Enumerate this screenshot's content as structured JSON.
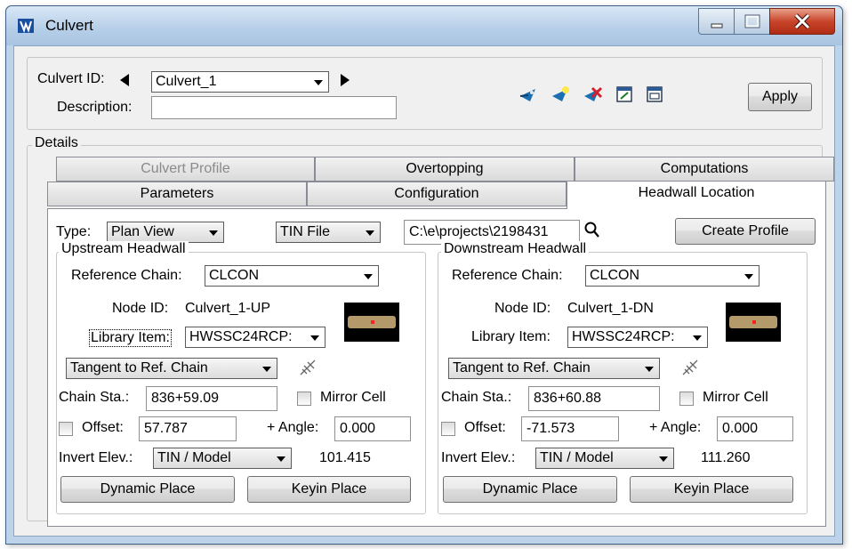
{
  "window": {
    "title": "Culvert",
    "icon": "culvert-app-icon"
  },
  "header": {
    "culvert_id_label": "Culvert ID:",
    "culvert_id_value": "Culvert_1",
    "description_label": "Description:",
    "description_value": "",
    "apply_label": "Apply",
    "toolbar_icons": [
      "add-culvert-icon",
      "edit-culvert-icon",
      "delete-culvert-icon",
      "open-dialog-icon",
      "report-icon"
    ]
  },
  "details": {
    "group_label": "Details",
    "tabs_row1": [
      {
        "label": "Culvert Profile",
        "disabled": true
      },
      {
        "label": "Overtopping"
      },
      {
        "label": "Computations"
      }
    ],
    "tabs_row2": [
      {
        "label": "Parameters"
      },
      {
        "label": "Configuration"
      },
      {
        "label": "Headwall Location",
        "active": true
      }
    ]
  },
  "headwall": {
    "type_label": "Type:",
    "type_value": "Plan View",
    "source_value": "TIN File",
    "path_value": "C:\\e\\projects\\2198431",
    "create_profile_label": "Create Profile",
    "upstream": {
      "group_label": "Upstream Headwall",
      "ref_chain_label": "Reference Chain:",
      "ref_chain_value": "CLCON",
      "node_id_label": "Node ID:",
      "node_id_value": "Culvert_1-UP",
      "library_item_label": "Library Item:",
      "library_item_value": "HWSSC24RCP:",
      "orientation_value": "Tangent to Ref. Chain",
      "chain_sta_label": "Chain Sta.:",
      "chain_sta_value": "836+59.09",
      "mirror_label": "Mirror Cell",
      "offset_label": "Offset:",
      "offset_value": "57.787",
      "angle_label": "+ Angle:",
      "angle_value": "0.000",
      "invert_label": "Invert Elev.:",
      "invert_source": "TIN / Model",
      "invert_value": "101.415",
      "dynamic_place_label": "Dynamic Place",
      "keyin_place_label": "Keyin Place"
    },
    "downstream": {
      "group_label": "Downstream Headwall",
      "ref_chain_label": "Reference Chain:",
      "ref_chain_value": "CLCON",
      "node_id_label": "Node ID:",
      "node_id_value": "Culvert_1-DN",
      "library_item_label": "Library Item:",
      "library_item_value": "HWSSC24RCP:",
      "orientation_value": "Tangent to Ref. Chain",
      "chain_sta_label": "Chain Sta.:",
      "chain_sta_value": "836+60.88",
      "mirror_label": "Mirror Cell",
      "offset_label": "Offset:",
      "offset_value": "-71.573",
      "angle_label": "+ Angle:",
      "angle_value": "0.000",
      "invert_label": "Invert Elev.:",
      "invert_source": "TIN / Model",
      "invert_value": "111.260",
      "dynamic_place_label": "Dynamic Place",
      "keyin_place_label": "Keyin Place"
    }
  }
}
